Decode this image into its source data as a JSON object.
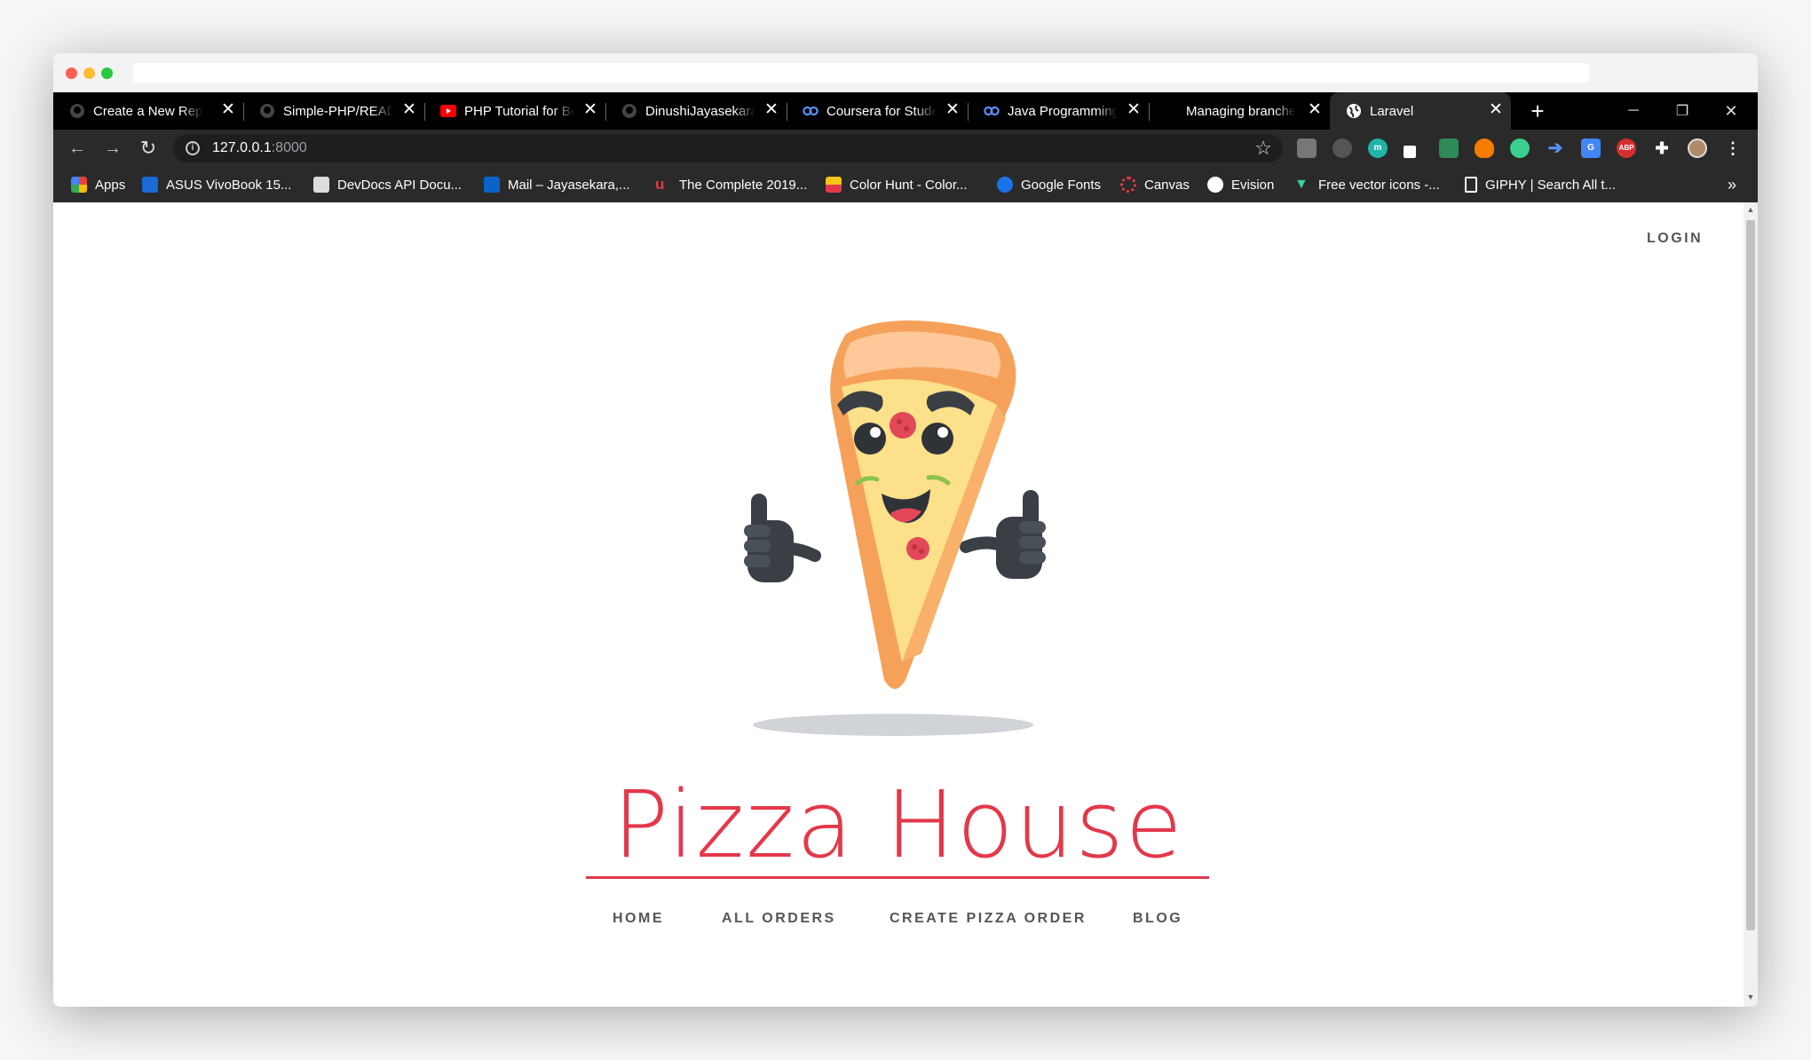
{
  "tabs": [
    {
      "title": "Create a New Repo",
      "icon": "github-icon"
    },
    {
      "title": "Simple-PHP/README",
      "icon": "github-icon"
    },
    {
      "title": "PHP Tutorial for Be",
      "icon": "youtube-icon"
    },
    {
      "title": "DinushiJayasekara",
      "icon": "github-icon"
    },
    {
      "title": "Coursera for Stude",
      "icon": "coursera-icon"
    },
    {
      "title": "Java Programming",
      "icon": "coursera-icon"
    },
    {
      "title": "Managing branche",
      "icon": "none"
    },
    {
      "title": "Laravel",
      "icon": "globe-icon"
    }
  ],
  "new_tab": "+",
  "window_controls": {
    "minimize": "─",
    "restore": "❐",
    "close": "✕"
  },
  "address": {
    "host": "127.0.0.1",
    "port": ":8000"
  },
  "bookmarks": [
    {
      "label": "Apps",
      "color": "#e94235"
    },
    {
      "label": "ASUS VivoBook 15...",
      "color": "#1a6ad8"
    },
    {
      "label": "DevDocs API Docu...",
      "color": "#dddddd"
    },
    {
      "label": "Mail – Jayasekara,...",
      "color": "#0a64c8"
    },
    {
      "label": "The Complete 2019...",
      "color": "#e3384a"
    },
    {
      "label": "Color Hunt - Color...",
      "color": "#f5c518"
    },
    {
      "label": "Google Fonts",
      "color": "#1a73e8"
    },
    {
      "label": "Canvas",
      "color": "#e3384a"
    },
    {
      "label": "Evision",
      "color": "#ffffff"
    },
    {
      "label": "Free vector icons -...",
      "color": "#3ccf91"
    },
    {
      "label": "GIPHY | Search All t...",
      "color": "#ffffff"
    }
  ],
  "bookmarks_more": "»",
  "page": {
    "login": "LOGIN",
    "title": "Pizza House",
    "menu": [
      "HOME",
      "ALL ORDERS",
      "CREATE PIZZA ORDER",
      "BLOG"
    ]
  },
  "colors": {
    "accent": "#e3384a",
    "pizza_crust": "#f6a15a",
    "pizza_cheese": "#fce08a",
    "pepperoni": "#e2485a"
  }
}
